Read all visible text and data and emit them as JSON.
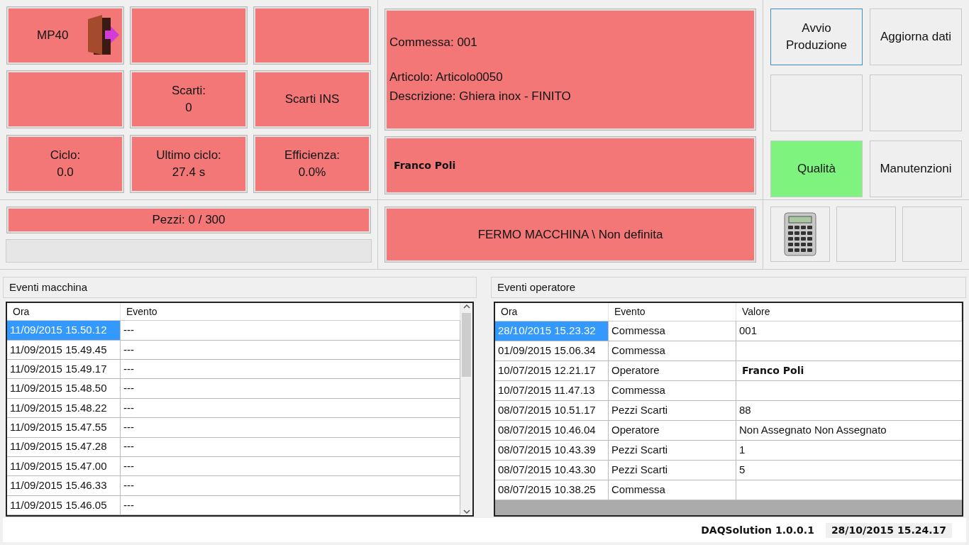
{
  "tiles": [
    {
      "kind": "exit",
      "lines": [
        "MP40"
      ]
    },
    {
      "kind": "blank"
    },
    {
      "kind": "blank"
    },
    {
      "kind": "blank"
    },
    {
      "kind": "text",
      "lines": [
        "Scarti:",
        "0"
      ]
    },
    {
      "kind": "text",
      "lines": [
        "Scarti INS"
      ]
    },
    {
      "kind": "text",
      "lines": [
        "Ciclo:",
        "0.0"
      ]
    },
    {
      "kind": "text",
      "lines": [
        "Ultimo ciclo:",
        "27.4 s"
      ]
    },
    {
      "kind": "text",
      "lines": [
        "Efficienza:",
        "0.0%"
      ]
    }
  ],
  "pieces": {
    "label": "Pezzi: 0 / 300",
    "level": 0
  },
  "job": {
    "order": "Commessa: 001",
    "article": "Articolo: Articolo0050",
    "description": "Descrizione: Ghiera inox - FINITO"
  },
  "operator": "Franco Poli",
  "machine_status": "FERMO MACCHINA \\ Non definita",
  "actions": [
    {
      "label": "Avvio Produzione",
      "focused": true,
      "highlighted": false
    },
    {
      "label": "Aggiorna dati",
      "focused": false,
      "highlighted": false
    },
    {
      "focused": false,
      "highlighted": false
    },
    {
      "focused": false,
      "highlighted": false
    },
    {
      "label": "Qualità",
      "focused": false,
      "highlighted": true
    },
    {
      "label": "Manutenzioni",
      "focused": false,
      "highlighted": false
    }
  ],
  "tools": [
    {
      "kind": "calculator"
    },
    {
      "kind": "blank"
    },
    {
      "kind": "blank"
    }
  ],
  "machine_events": {
    "title": "Eventi macchina",
    "columns": [
      "Ora",
      "Evento"
    ],
    "rows": [
      {
        "time": "11/09/2015 15.50.12",
        "event": "---",
        "selected": true
      },
      {
        "time": "11/09/2015 15.49.45",
        "event": "---",
        "selected": false
      },
      {
        "time": "11/09/2015 15.49.17",
        "event": "---",
        "selected": false
      },
      {
        "time": "11/09/2015 15.48.50",
        "event": "---",
        "selected": false
      },
      {
        "time": "11/09/2015 15.48.22",
        "event": "---",
        "selected": false
      },
      {
        "time": "11/09/2015 15.47.55",
        "event": "---",
        "selected": false
      },
      {
        "time": "11/09/2015 15.47.28",
        "event": "---",
        "selected": false
      },
      {
        "time": "11/09/2015 15.47.00",
        "event": "---",
        "selected": false
      },
      {
        "time": "11/09/2015 15.46.33",
        "event": "---",
        "selected": false
      },
      {
        "time": "11/09/2015 15.46.05",
        "event": "---",
        "selected": false
      }
    ]
  },
  "operator_events": {
    "title": "Eventi operatore",
    "columns": [
      "Ora",
      "Evento",
      "Valore"
    ],
    "rows": [
      {
        "time": "28/10/2015 15.23.32",
        "event": "Commessa",
        "value": "001",
        "selected": true,
        "bold": false
      },
      {
        "time": "01/09/2015 15.06.34",
        "event": "Commessa",
        "selected": false
      },
      {
        "time": "10/07/2015 12.21.17",
        "event": "Operatore",
        "value": "Franco Poli",
        "selected": false,
        "bold": true
      },
      {
        "time": "10/07/2015 11.47.13",
        "event": "Commessa",
        "selected": false
      },
      {
        "time": "08/07/2015 10.51.17",
        "event": "Pezzi Scarti",
        "value": "88",
        "selected": false,
        "bold": false
      },
      {
        "time": "08/07/2015 10.46.04",
        "event": "Operatore",
        "value": "Non Assegnato Non Assegnato",
        "selected": false,
        "bold": false
      },
      {
        "time": "08/07/2015 10.43.39",
        "event": "Pezzi Scarti",
        "value": "1",
        "selected": false,
        "bold": false
      },
      {
        "time": "08/07/2015 10.43.30",
        "event": "Pezzi Scarti",
        "value": "5",
        "selected": false,
        "bold": false
      },
      {
        "time": "08/07/2015 10.38.25",
        "event": "Commessa",
        "selected": false
      }
    ]
  },
  "status_bar": {
    "app": "DAQSolution 1.0.0.1",
    "datetime": "28/10/2015 15.24.17"
  }
}
